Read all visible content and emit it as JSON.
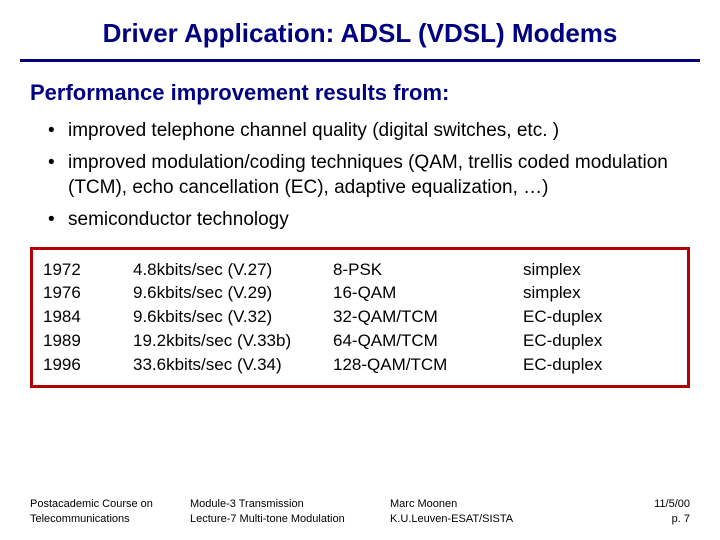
{
  "title": "Driver Application: ADSL (VDSL) Modems",
  "subhead": "Performance improvement results from:",
  "bullets": [
    "improved telephone channel quality (digital switches, etc. )",
    "improved modulation/coding techniques (QAM, trellis coded modulation (TCM), echo cancellation (EC), adaptive equalization, …)",
    "semiconductor technology"
  ],
  "table": [
    {
      "year": "1972",
      "rate": "4.8kbits/sec (V.27)",
      "mod": "8-PSK",
      "duplex": "simplex"
    },
    {
      "year": "1976",
      "rate": "9.6kbits/sec (V.29)",
      "mod": "16-QAM",
      "duplex": "simplex"
    },
    {
      "year": "1984",
      "rate": "9.6kbits/sec (V.32)",
      "mod": "32-QAM/TCM",
      "duplex": "EC-duplex"
    },
    {
      "year": "1989",
      "rate": "19.2kbits/sec (V.33b)",
      "mod": "64-QAM/TCM",
      "duplex": "EC-duplex"
    },
    {
      "year": "1996",
      "rate": "33.6kbits/sec (V.34)",
      "mod": "128-QAM/TCM",
      "duplex": "EC-duplex"
    }
  ],
  "footer": {
    "course_line1": "Postacademic Course on",
    "course_line2": "Telecommunications",
    "module_line1": "Module-3  Transmission",
    "module_line2": "Lecture-7  Multi-tone Modulation",
    "author_line1": "Marc Moonen",
    "author_line2": "K.U.Leuven-ESAT/SISTA",
    "date": "11/5/00",
    "page": "p. 7"
  }
}
